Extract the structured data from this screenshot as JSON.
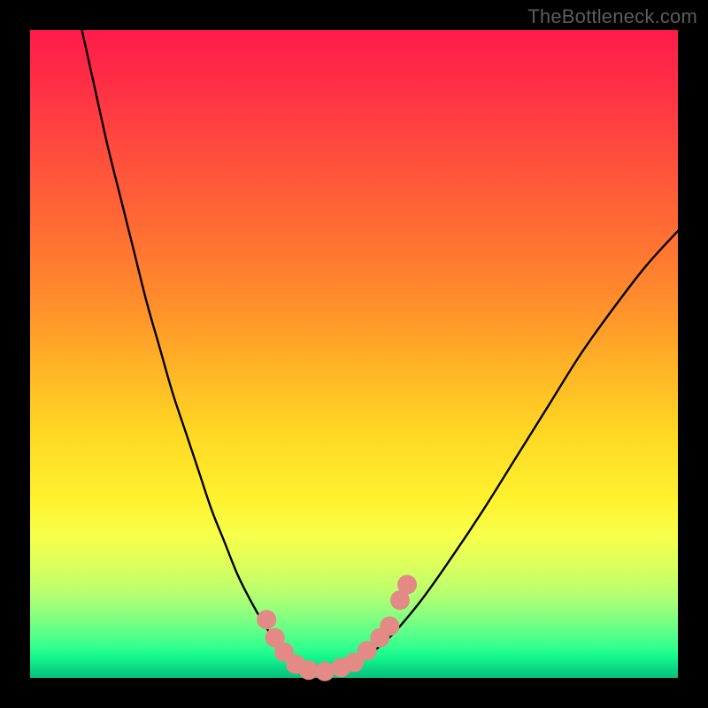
{
  "watermark": "TheBottleneck.com",
  "colors": {
    "curve": "#000000",
    "marker_fill": "#e38a86",
    "marker_stroke": "#c77570",
    "background_frame": "#000000"
  },
  "chart_data": {
    "type": "line",
    "title": "",
    "xlabel": "",
    "ylabel": "",
    "xlim": [
      0,
      100
    ],
    "ylim": [
      0,
      100
    ],
    "grid": false,
    "legend": false,
    "series": [
      {
        "name": "bottleneck-curve",
        "x": [
          8,
          10,
          12,
          14,
          16,
          18,
          20,
          22,
          24,
          26,
          28,
          30,
          32,
          34,
          36,
          38,
          40,
          42,
          45,
          50,
          55,
          60,
          65,
          70,
          75,
          80,
          85,
          90,
          95,
          100
        ],
        "y": [
          100,
          91,
          82,
          74,
          66,
          58,
          51,
          44,
          38,
          32,
          26,
          21,
          16,
          12,
          8.5,
          5.5,
          3.2,
          1.6,
          1.0,
          2.2,
          5.8,
          11.5,
          18.5,
          26,
          34,
          42,
          50,
          57,
          63.5,
          69
        ]
      }
    ],
    "markers": [
      {
        "x": 36.5,
        "y": 9.0
      },
      {
        "x": 37.8,
        "y": 6.2
      },
      {
        "x": 39.2,
        "y": 4.0
      },
      {
        "x": 41.0,
        "y": 2.1
      },
      {
        "x": 43.0,
        "y": 1.2
      },
      {
        "x": 45.5,
        "y": 1.0
      },
      {
        "x": 48.0,
        "y": 1.6
      },
      {
        "x": 50.0,
        "y": 2.4
      },
      {
        "x": 52.0,
        "y": 4.2
      },
      {
        "x": 54.0,
        "y": 6.2
      },
      {
        "x": 55.5,
        "y": 8.0
      },
      {
        "x": 57.1,
        "y": 12.0
      },
      {
        "x": 58.2,
        "y": 14.4
      }
    ],
    "marker_radius_px": 11
  }
}
